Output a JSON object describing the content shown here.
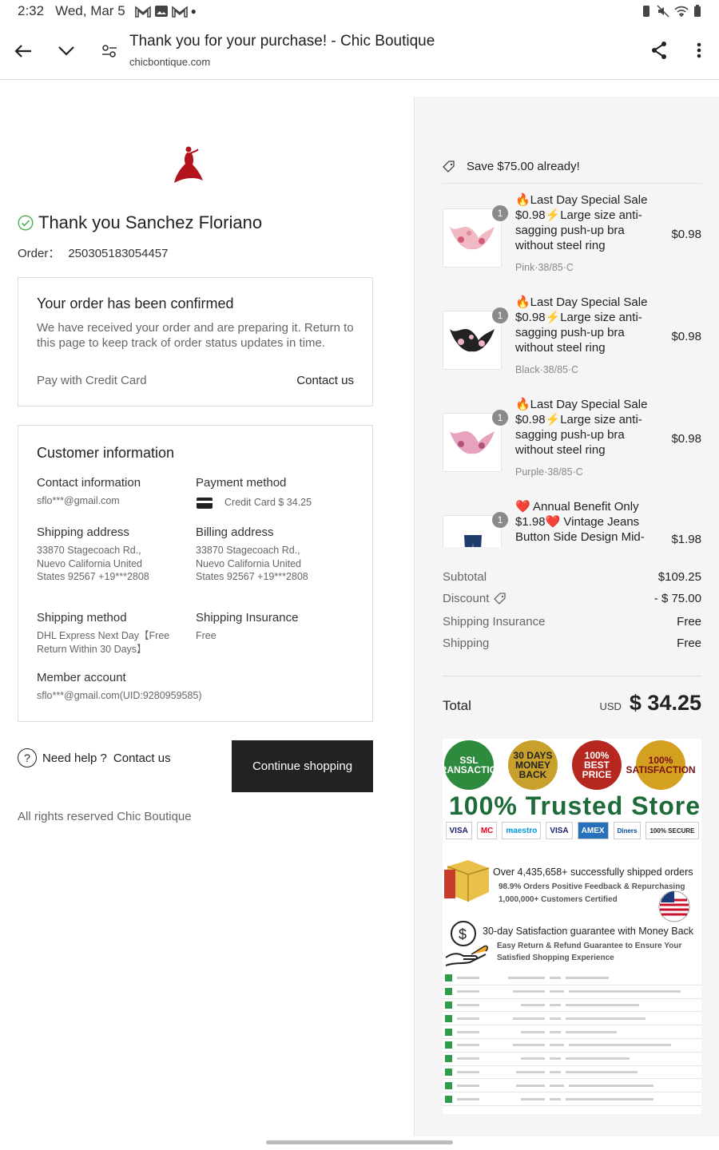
{
  "status_bar": {
    "time": "2:32",
    "date": "Wed, Mar 5"
  },
  "toolbar": {
    "title": "Thank you for your purchase! - Chic Boutique",
    "url": "chicbontique.com"
  },
  "thanks": {
    "heading": "Thank you Sanchez Floriano",
    "order_label": "Order：",
    "order_number": "250305183054457"
  },
  "confirm_card": {
    "title": "Your order has been confirmed",
    "body": "We have received your order and are preparing it. Return to this page to keep track of order status updates in time.",
    "pay_with": "Pay with Credit Card",
    "contact": "Contact us"
  },
  "customer": {
    "title": "Customer information",
    "contact_label": "Contact information",
    "contact_value": "sflo***@gmail.com",
    "payment_label": "Payment method",
    "payment_value": "Credit Card $ 34.25",
    "shipping_address_label": "Shipping address",
    "shipping_address_value": "33870 Stagecoach Rd., Nuevo California United States 92567 +19***2808",
    "billing_address_label": "Billing address",
    "billing_address_value": "33870 Stagecoach Rd., Nuevo California United States 92567 +19***2808",
    "shipping_method_label": "Shipping method",
    "shipping_method_value": "DHL Express Next Day【Free Return Within 30 Days】",
    "insurance_label": "Shipping Insurance",
    "insurance_value": "Free",
    "member_label": "Member account",
    "member_value": "sflo***@gmail.com(UID:9280959585)"
  },
  "help": {
    "text": "Need help ?",
    "link": "Contact us",
    "continue": "Continue shopping",
    "rights": "All rights reserved Chic Boutique"
  },
  "summary": {
    "save_text": "Save $75.00 already!",
    "items": [
      {
        "title": "🔥Last Day Special Sale $0.98⚡Large size anti-sagging push-up bra without steel ring",
        "variant": "Pink·38/85·C",
        "price": "$0.98",
        "qty": "1"
      },
      {
        "title": "🔥Last Day Special Sale $0.98⚡Large size anti-sagging push-up bra without steel ring",
        "variant": "Black·38/85·C",
        "price": "$0.98",
        "qty": "1"
      },
      {
        "title": "🔥Last Day Special Sale $0.98⚡Large size anti-sagging push-up bra without steel ring",
        "variant": "Purple·38/85·C",
        "price": "$0.98",
        "qty": "1"
      },
      {
        "title": "❤️ Annual Benefit Only $1.98❤️ Vintage Jeans Button Side Design Mid-",
        "variant": "",
        "price": "$1.98",
        "qty": "1"
      }
    ],
    "subtotal_label": "Subtotal",
    "subtotal_value": "$109.25",
    "discount_label": "Discount",
    "discount_value": "- $ 75.00",
    "insurance_label": "Shipping Insurance",
    "insurance_value": "Free",
    "shipping_label": "Shipping",
    "shipping_value": "Free",
    "total_label": "Total",
    "currency": "USD",
    "total_value": "$ 34.25"
  },
  "trust": {
    "seals": [
      "SSL TRANSACTION",
      "30 DAYS MONEY BACK",
      "100% BEST PRICE",
      "100% SATISFACTION"
    ],
    "headline": "100% Trusted Store",
    "payments": [
      "VISA",
      "MC",
      "maestro",
      "VISA",
      "AMEX",
      "Diners",
      "100% SECURE"
    ],
    "stat1_main": "Over 4,435,658+ successfully shipped orders",
    "stat1_sub1": "98.9% Orders Positive Feedback & Repurchasing",
    "stat1_sub2": "1,000,000+ Customers Certified",
    "stat2_main": "30-day Satisfaction guarantee with Money Back",
    "stat2_sub1": "Easy Return & Refund Guarantee to Ensure Your",
    "stat2_sub2": "Satisfied Shopping Experience"
  },
  "colors": {
    "button_dark": "#222222",
    "check_green": "#4caf50",
    "trusted_green": "#1e6b3a"
  }
}
